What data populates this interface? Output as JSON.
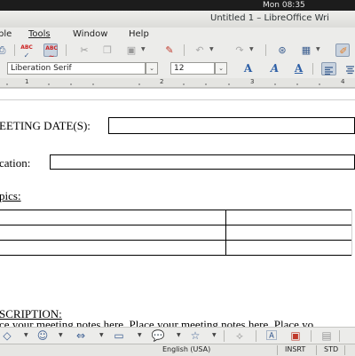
{
  "top_panel": {
    "clock": "Mon 08:35"
  },
  "window": {
    "title": "Untitled 1 – LibreOffice Wri"
  },
  "menubar": {
    "items": [
      {
        "label": "ble"
      },
      {
        "label": "Tools"
      },
      {
        "label": "Window"
      },
      {
        "label": "Help"
      }
    ]
  },
  "formatting": {
    "font_name": "Liberation Serif",
    "font_size": "12"
  },
  "ruler": {
    "numbers": [
      "1",
      "2",
      "3",
      "4"
    ]
  },
  "document": {
    "meeting_date_label": "EETING DATE(S):",
    "location_label": "cation:",
    "topics_label": "pics:",
    "description_label": "SCRIPTION:",
    "description_text": "ce your meeting notes here. Place your meeting notes here. Place yo"
  },
  "statusbar": {
    "language": "English (USA)",
    "insert_mode": "INSRT",
    "selection_mode": "STD"
  }
}
